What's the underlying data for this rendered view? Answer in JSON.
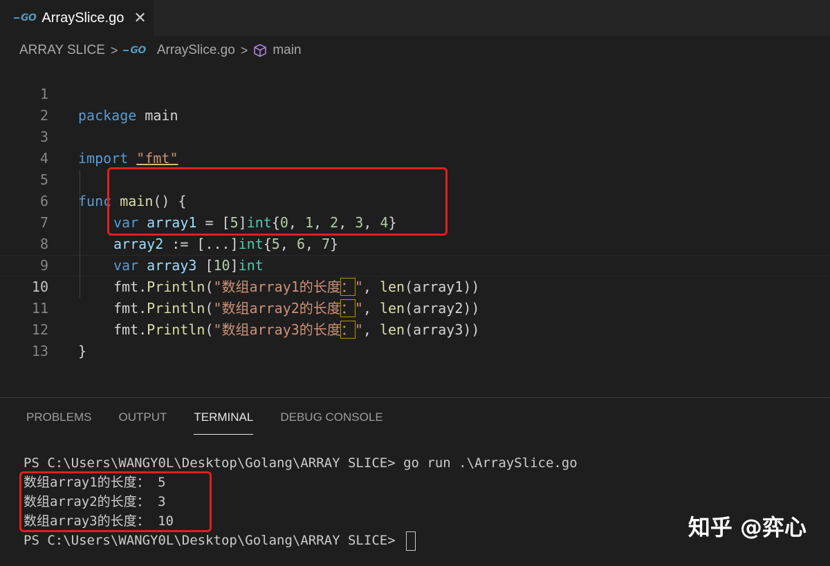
{
  "tab": {
    "icon": "go-icon",
    "label": "ArraySlice.go"
  },
  "breadcrumb": {
    "folder": "ARRAY SLICE",
    "file": "ArraySlice.go",
    "symbol": "main"
  },
  "editor": {
    "line_numbers": [
      "1",
      "2",
      "3",
      "4",
      "5",
      "6",
      "7",
      "8",
      "9",
      "10",
      "11",
      "12",
      "13"
    ],
    "lines": {
      "l1": {
        "kw": "package",
        "rest": " main"
      },
      "l3": {
        "kw": "import",
        "sp": " ",
        "str": "\"fmt\""
      },
      "l5": {
        "kw": "func",
        "sp": " ",
        "fn": "main",
        "rest": "() {"
      },
      "l6": {
        "kw": "var",
        "sp": " ",
        "var": "array1",
        "eq": " = [",
        "n": "5",
        "br": "]",
        "ty": "int",
        "ob": "{",
        "v0": "0",
        "c1": ", ",
        "v1": "1",
        "c2": ", ",
        "v2": "2",
        "c3": ", ",
        "v3": "3",
        "c4": ", ",
        "v4": "4",
        "cb": "}"
      },
      "l7": {
        "var": "array2",
        "eq": " := [...]",
        "ty": "int",
        "ob": "{",
        "v0": "5",
        "c1": ", ",
        "v1": "6",
        "c2": ", ",
        "v2": "7",
        "cb": "}"
      },
      "l8": {
        "kw": "var",
        "sp": " ",
        "var": "array3",
        "ob": " [",
        "n": "10",
        "br": "]",
        "ty": "int"
      },
      "l9": {
        "pkg": "fmt",
        "dot": ".",
        "fn": "Println",
        "op": "(",
        "str": "\"数组array1的长度",
        "colon": "：",
        "end": "\"",
        "rest": ", ",
        "len": "len",
        "args": "(array1))"
      },
      "l10": {
        "pkg": "fmt",
        "dot": ".",
        "fn": "Println",
        "op": "(",
        "str": "\"数组array2的长度",
        "colon": "：",
        "end": "\"",
        "rest": ", ",
        "len": "len",
        "args": "(array2))"
      },
      "l11": {
        "pkg": "fmt",
        "dot": ".",
        "fn": "Println",
        "op": "(",
        "str": "\"数组array3的长度",
        "colon": "：",
        "end": "\"",
        "rest": ", ",
        "len": "len",
        "args": "(array3))"
      },
      "l12": {
        "rest": "}"
      }
    }
  },
  "panel": {
    "tabs": [
      "PROBLEMS",
      "OUTPUT",
      "TERMINAL",
      "DEBUG CONSOLE"
    ],
    "active_tab": "TERMINAL",
    "terminal": [
      "PS C:\\Users\\WANGY0L\\Desktop\\Golang\\ARRAY SLICE> go run .\\ArraySlice.go",
      "数组array1的长度： 5",
      "数组array2的长度： 3",
      "数组array3的长度： 10",
      "PS C:\\Users\\WANGY0L\\Desktop\\Golang\\ARRAY SLICE> "
    ]
  },
  "watermark": "知乎 @弈心",
  "colors": {
    "keyword": "#569cd6",
    "string": "#ce9178",
    "function": "#dcdcaa",
    "variable": "#9cdcfe",
    "type": "#4ec9b0",
    "number": "#b5cea8",
    "highlight_box": "#e02020"
  }
}
